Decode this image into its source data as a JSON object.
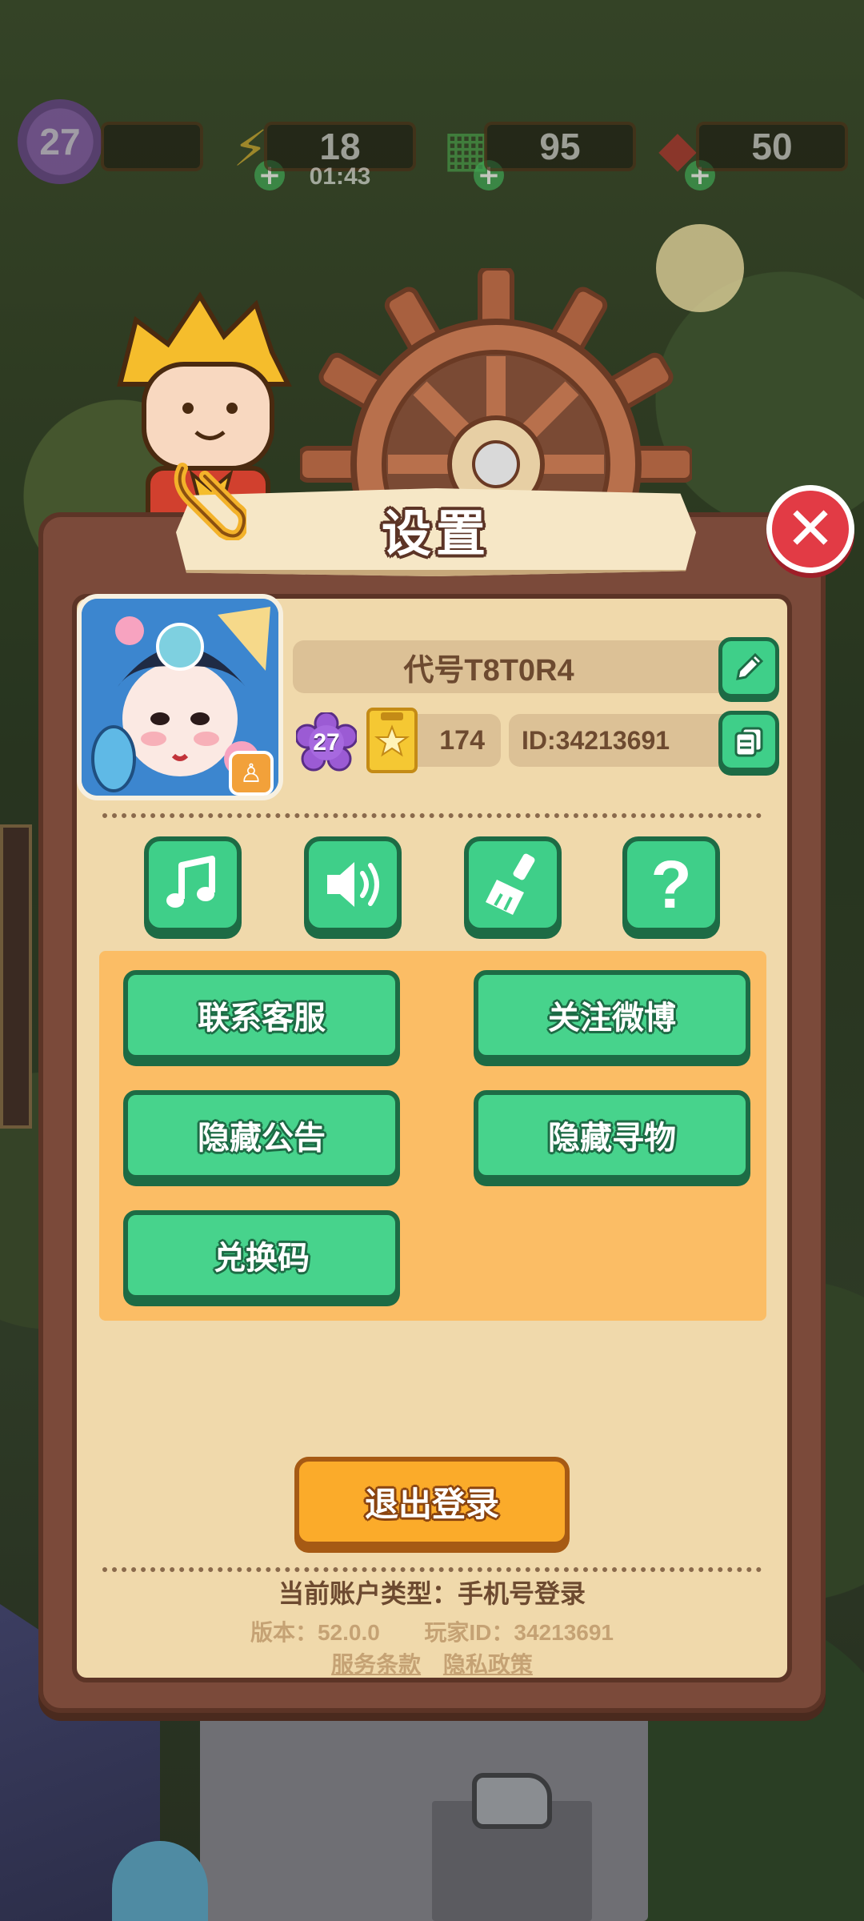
{
  "hud": {
    "level": "27",
    "energy": "18",
    "energy_timer": "01:43",
    "cash": "95",
    "gems": "50"
  },
  "dialog": {
    "title": "设置",
    "profile": {
      "name": "代号T8T0R4",
      "level": "27",
      "stars": "174",
      "id_label": "ID:34213691"
    },
    "icons": [
      "music-icon",
      "sound-icon",
      "broom-icon",
      "help-icon"
    ],
    "buttons": {
      "contact_service": "联系客服",
      "follow_weibo": "关注微博",
      "hide_notice": "隐藏公告",
      "hide_search": "隐藏寻物",
      "redeem_code": "兑换码"
    },
    "logout": "退出登录",
    "footer": {
      "account_type": "当前账户类型：手机号登录",
      "version": "版本：52.0.0",
      "player_id": "玩家ID：34213691",
      "terms": "服务条款",
      "privacy": "隐私政策"
    }
  },
  "colors": {
    "panel": "#7b4a3a",
    "inner": "#f0d9ab",
    "green": "#47d38c",
    "orange_area": "#fbbd65",
    "logout": "#fbab2a",
    "close": "#e23b45"
  }
}
